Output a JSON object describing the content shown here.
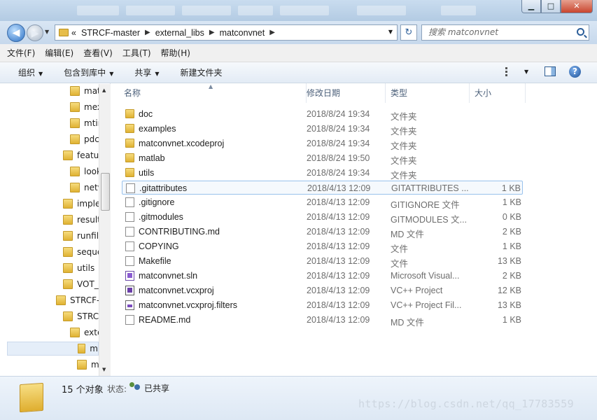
{
  "address": {
    "overflow": "«",
    "crumbs": [
      "STRCF-master",
      "external_libs",
      "matconvnet"
    ]
  },
  "search": {
    "placeholder": "搜索 matconvnet"
  },
  "menu": [
    "文件(F)",
    "编辑(E)",
    "查看(V)",
    "工具(T)",
    "帮助(H)"
  ],
  "toolbar": {
    "organize": "组织",
    "include": "包含到库中",
    "share": "共享",
    "new_folder": "新建文件夹"
  },
  "tree": [
    {
      "label": "mat",
      "level": 3
    },
    {
      "label": "mex",
      "level": 3
    },
    {
      "label": "mtir",
      "level": 3
    },
    {
      "label": "pdc",
      "level": 3
    },
    {
      "label": "featur",
      "level": 2
    },
    {
      "label": "look",
      "level": 3
    },
    {
      "label": "netw",
      "level": 3
    },
    {
      "label": "imple",
      "level": 2
    },
    {
      "label": "result",
      "level": 2
    },
    {
      "label": "runfile",
      "level": 2
    },
    {
      "label": "seque",
      "level": 2
    },
    {
      "label": "utils",
      "level": 2
    },
    {
      "label": "VOT_",
      "level": 2
    },
    {
      "label": "STRCF-",
      "level": 1
    },
    {
      "label": "STRC",
      "level": 2
    },
    {
      "label": "exte",
      "level": 3
    },
    {
      "label": "m",
      "level": 4,
      "selected": true
    },
    {
      "label": "m",
      "level": 4
    }
  ],
  "columns": {
    "name": "名称",
    "date": "修改日期",
    "type": "类型",
    "size": "大小"
  },
  "files": [
    {
      "name": "doc",
      "date": "2018/8/24 19:34",
      "type": "文件夹",
      "size": "",
      "icon": "folder"
    },
    {
      "name": "examples",
      "date": "2018/8/24 19:34",
      "type": "文件夹",
      "size": "",
      "icon": "folder"
    },
    {
      "name": "matconvnet.xcodeproj",
      "date": "2018/8/24 19:34",
      "type": "文件夹",
      "size": "",
      "icon": "folder"
    },
    {
      "name": "matlab",
      "date": "2018/8/24 19:50",
      "type": "文件夹",
      "size": "",
      "icon": "folder"
    },
    {
      "name": "utils",
      "date": "2018/8/24 19:34",
      "type": "文件夹",
      "size": "",
      "icon": "folder"
    },
    {
      "name": ".gitattributes",
      "date": "2018/4/13 12:09",
      "type": "GITATTRIBUTES ...",
      "size": "1 KB",
      "icon": "file",
      "highlight": true
    },
    {
      "name": ".gitignore",
      "date": "2018/4/13 12:09",
      "type": "GITIGNORE 文件",
      "size": "1 KB",
      "icon": "file"
    },
    {
      "name": ".gitmodules",
      "date": "2018/4/13 12:09",
      "type": "GITMODULES 文...",
      "size": "0 KB",
      "icon": "file"
    },
    {
      "name": "CONTRIBUTING.md",
      "date": "2018/4/13 12:09",
      "type": "MD 文件",
      "size": "2 KB",
      "icon": "file"
    },
    {
      "name": "COPYING",
      "date": "2018/4/13 12:09",
      "type": "文件",
      "size": "1 KB",
      "icon": "file"
    },
    {
      "name": "Makefile",
      "date": "2018/4/13 12:09",
      "type": "文件",
      "size": "13 KB",
      "icon": "file"
    },
    {
      "name": "matconvnet.sln",
      "date": "2018/4/13 12:09",
      "type": "Microsoft Visual...",
      "size": "2 KB",
      "icon": "sln"
    },
    {
      "name": "matconvnet.vcxproj",
      "date": "2018/4/13 12:09",
      "type": "VC++ Project",
      "size": "12 KB",
      "icon": "proj"
    },
    {
      "name": "matconvnet.vcxproj.filters",
      "date": "2018/4/13 12:09",
      "type": "VC++ Project Fil...",
      "size": "13 KB",
      "icon": "filter"
    },
    {
      "name": "README.md",
      "date": "2018/4/13 12:09",
      "type": "MD 文件",
      "size": "1 KB",
      "icon": "file"
    }
  ],
  "status": {
    "count": "15 个对象",
    "state_label": "状态:",
    "state_value": "已共享"
  },
  "watermark": "https://blog.csdn.net/qq_17783559"
}
